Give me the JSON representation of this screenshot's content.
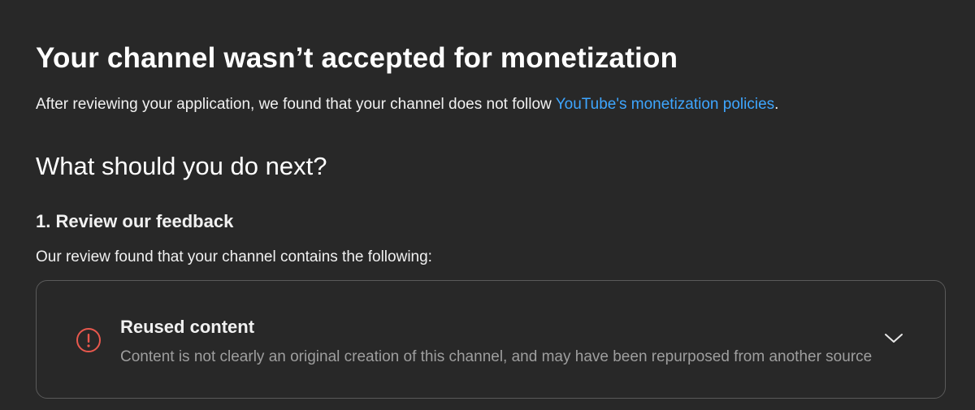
{
  "main": {
    "title": "Your channel wasn’t accepted for monetization",
    "intro_text": "After reviewing your application, we found that your channel does not follow ",
    "intro_link": "YouTube's monetization policies",
    "intro_end": ".",
    "next_heading": "What should you do next?",
    "step1": {
      "heading": "1. Review our feedback",
      "description": "Our review found that your channel contains the following:"
    },
    "feedback_card": {
      "icon": "error-icon",
      "title": "Reused content",
      "description": "Content is not clearly an original creation of this channel, and may have been repurposed from another source",
      "expand_icon": "chevron-down-icon"
    }
  },
  "colors": {
    "background": "#282828",
    "link": "#3ea6ff",
    "error": "#e8584d",
    "border": "#5a5a5a",
    "secondary_text": "#9e9e9e"
  }
}
